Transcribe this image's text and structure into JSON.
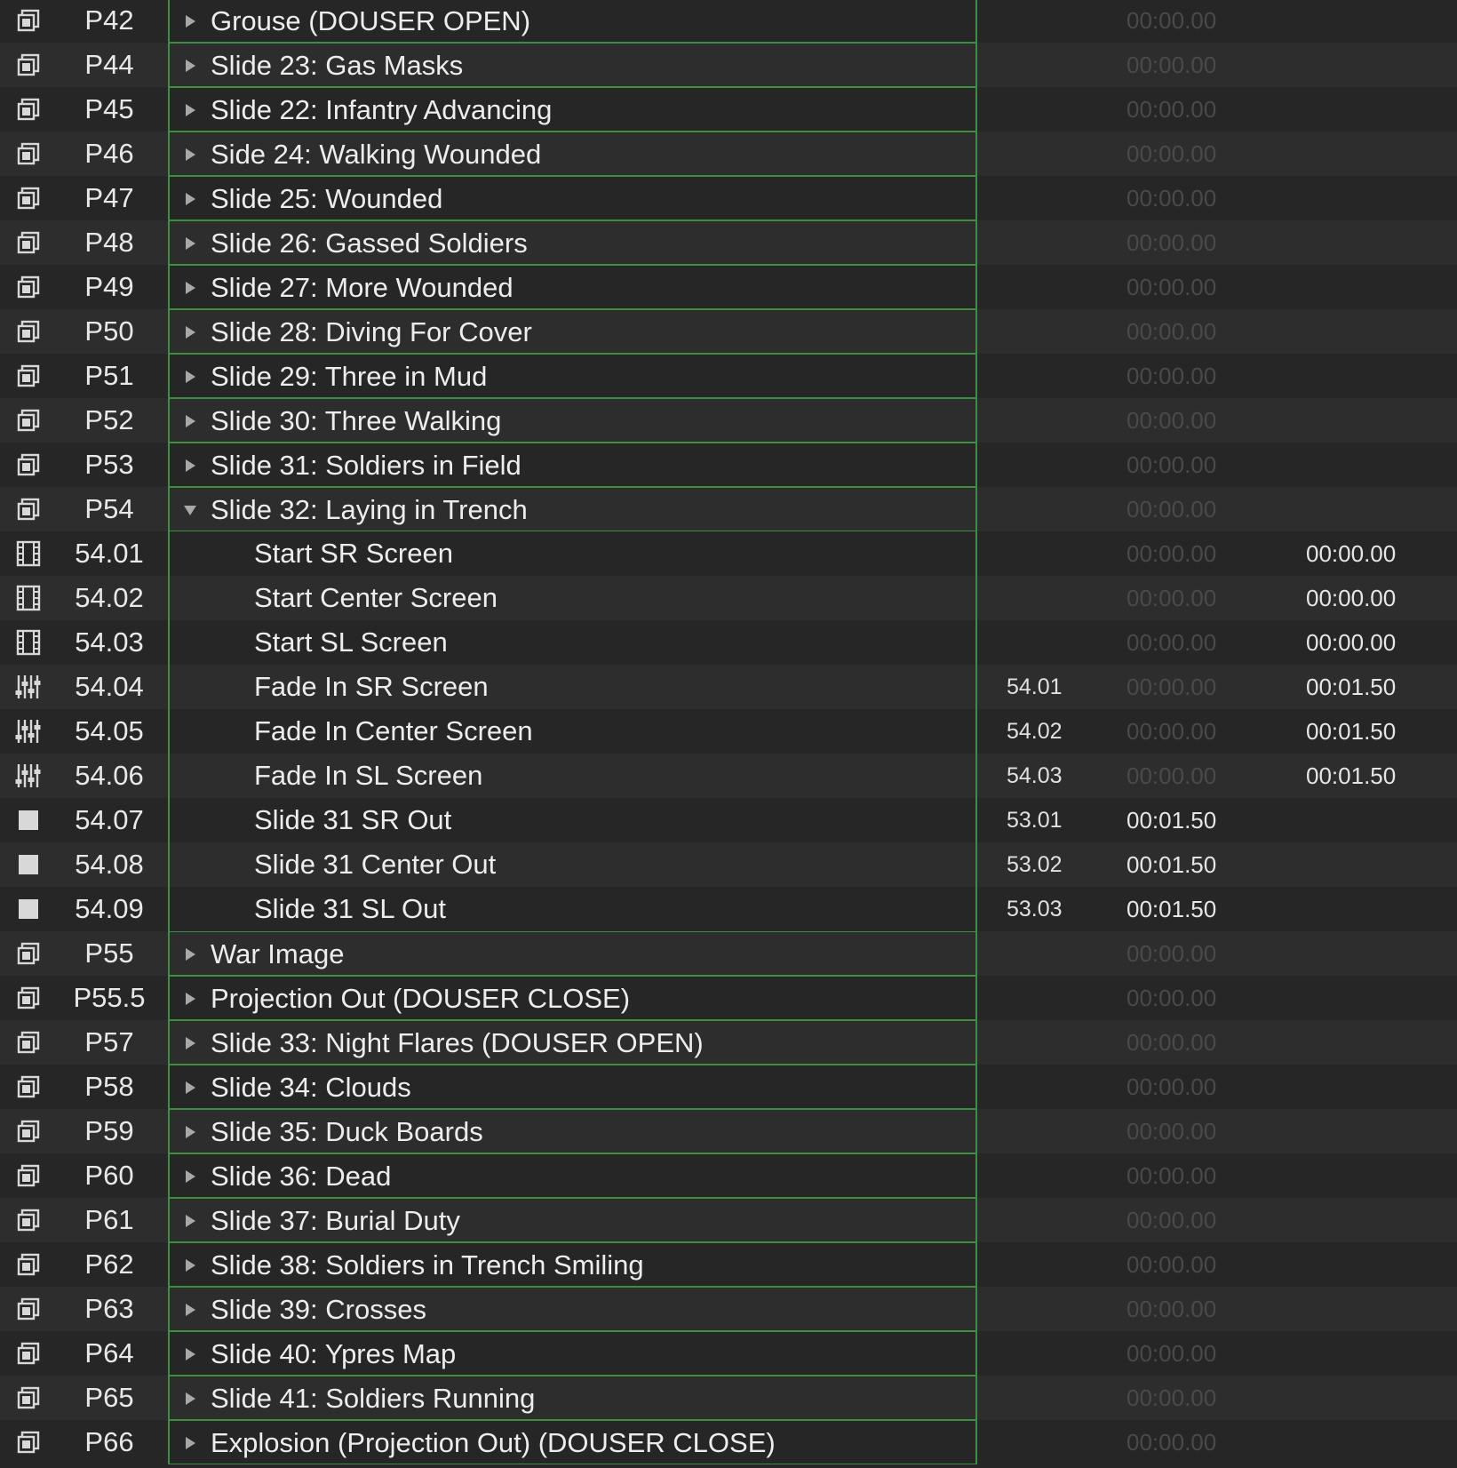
{
  "cues": [
    {
      "number": "P42",
      "name": "Grouse (DOUSER OPEN)",
      "kind": "group",
      "icon": "group-icon",
      "expanded": false,
      "target": "",
      "prewait": "00:00.00",
      "duration": ""
    },
    {
      "number": "P44",
      "name": "Slide 23: Gas Masks",
      "kind": "group",
      "icon": "group-icon",
      "expanded": false,
      "target": "",
      "prewait": "00:00.00",
      "duration": ""
    },
    {
      "number": "P45",
      "name": "Slide 22: Infantry Advancing",
      "kind": "group",
      "icon": "group-icon",
      "expanded": false,
      "target": "",
      "prewait": "00:00.00",
      "duration": ""
    },
    {
      "number": "P46",
      "name": "Side 24: Walking Wounded",
      "kind": "group",
      "icon": "group-icon",
      "expanded": false,
      "target": "",
      "prewait": "00:00.00",
      "duration": ""
    },
    {
      "number": "P47",
      "name": "Slide 25: Wounded",
      "kind": "group",
      "icon": "group-icon",
      "expanded": false,
      "target": "",
      "prewait": "00:00.00",
      "duration": ""
    },
    {
      "number": "P48",
      "name": "Slide 26: Gassed Soldiers",
      "kind": "group",
      "icon": "group-icon",
      "expanded": false,
      "target": "",
      "prewait": "00:00.00",
      "duration": ""
    },
    {
      "number": "P49",
      "name": "Slide 27: More Wounded",
      "kind": "group",
      "icon": "group-icon",
      "expanded": false,
      "target": "",
      "prewait": "00:00.00",
      "duration": ""
    },
    {
      "number": "P50",
      "name": "Slide 28: Diving For Cover",
      "kind": "group",
      "icon": "group-icon",
      "expanded": false,
      "target": "",
      "prewait": "00:00.00",
      "duration": ""
    },
    {
      "number": "P51",
      "name": "Slide 29: Three in Mud",
      "kind": "group",
      "icon": "group-icon",
      "expanded": false,
      "target": "",
      "prewait": "00:00.00",
      "duration": ""
    },
    {
      "number": "P52",
      "name": "Slide 30: Three Walking",
      "kind": "group",
      "icon": "group-icon",
      "expanded": false,
      "target": "",
      "prewait": "00:00.00",
      "duration": ""
    },
    {
      "number": "P53",
      "name": "Slide 31: Soldiers in Field",
      "kind": "group",
      "icon": "group-icon",
      "expanded": false,
      "target": "",
      "prewait": "00:00.00",
      "duration": ""
    },
    {
      "number": "P54",
      "name": "Slide 32: Laying in Trench",
      "kind": "group",
      "icon": "group-icon",
      "expanded": true,
      "target": "",
      "prewait": "00:00.00",
      "duration": ""
    },
    {
      "number": "54.01",
      "name": "Start SR Screen",
      "kind": "child",
      "icon": "video-cue-icon",
      "target": "",
      "prewait": "00:00.00",
      "duration": "00:00.00"
    },
    {
      "number": "54.02",
      "name": "Start Center Screen",
      "kind": "child",
      "icon": "video-cue-icon",
      "target": "",
      "prewait": "00:00.00",
      "duration": "00:00.00"
    },
    {
      "number": "54.03",
      "name": "Start SL Screen",
      "kind": "child",
      "icon": "video-cue-icon",
      "target": "",
      "prewait": "00:00.00",
      "duration": "00:00.00"
    },
    {
      "number": "54.04",
      "name": "Fade In SR Screen",
      "kind": "child",
      "icon": "fade-cue-icon",
      "target": "54.01",
      "prewait": "00:00.00",
      "duration": "00:01.50"
    },
    {
      "number": "54.05",
      "name": "Fade In Center Screen",
      "kind": "child",
      "icon": "fade-cue-icon",
      "target": "54.02",
      "prewait": "00:00.00",
      "duration": "00:01.50"
    },
    {
      "number": "54.06",
      "name": "Fade In SL Screen",
      "kind": "child",
      "icon": "fade-cue-icon",
      "target": "54.03",
      "prewait": "00:00.00",
      "duration": "00:01.50"
    },
    {
      "number": "54.07",
      "name": "Slide 31 SR Out",
      "kind": "child",
      "icon": "stop-cue-icon",
      "target": "53.01",
      "prewait": "00:01.50",
      "prewait_active": true,
      "duration": ""
    },
    {
      "number": "54.08",
      "name": "Slide 31 Center Out",
      "kind": "child",
      "icon": "stop-cue-icon",
      "target": "53.02",
      "prewait": "00:01.50",
      "prewait_active": true,
      "duration": ""
    },
    {
      "number": "54.09",
      "name": "Slide 31 SL Out",
      "kind": "child",
      "icon": "stop-cue-icon",
      "target": "53.03",
      "prewait": "00:01.50",
      "prewait_active": true,
      "duration": ""
    },
    {
      "number": "P55",
      "name": "War Image",
      "kind": "group",
      "icon": "group-icon",
      "expanded": false,
      "target": "",
      "prewait": "00:00.00",
      "duration": ""
    },
    {
      "number": "P55.5",
      "name": "Projection Out (DOUSER CLOSE)",
      "kind": "group",
      "icon": "group-icon",
      "expanded": false,
      "target": "",
      "prewait": "00:00.00",
      "duration": ""
    },
    {
      "number": "P57",
      "name": "Slide 33: Night Flares (DOUSER OPEN)",
      "kind": "group",
      "icon": "group-icon",
      "expanded": false,
      "target": "",
      "prewait": "00:00.00",
      "duration": ""
    },
    {
      "number": "P58",
      "name": "Slide 34: Clouds",
      "kind": "group",
      "icon": "group-icon",
      "expanded": false,
      "target": "",
      "prewait": "00:00.00",
      "duration": ""
    },
    {
      "number": "P59",
      "name": "Slide 35: Duck Boards",
      "kind": "group",
      "icon": "group-icon",
      "expanded": false,
      "target": "",
      "prewait": "00:00.00",
      "duration": ""
    },
    {
      "number": "P60",
      "name": "Slide 36: Dead",
      "kind": "group",
      "icon": "group-icon",
      "expanded": false,
      "target": "",
      "prewait": "00:00.00",
      "duration": ""
    },
    {
      "number": "P61",
      "name": "Slide 37: Burial Duty",
      "kind": "group",
      "icon": "group-icon",
      "expanded": false,
      "target": "",
      "prewait": "00:00.00",
      "duration": ""
    },
    {
      "number": "P62",
      "name": "Slide 38: Soldiers in Trench Smiling",
      "kind": "group",
      "icon": "group-icon",
      "expanded": false,
      "target": "",
      "prewait": "00:00.00",
      "duration": ""
    },
    {
      "number": "P63",
      "name": "Slide 39: Crosses",
      "kind": "group",
      "icon": "group-icon",
      "expanded": false,
      "target": "",
      "prewait": "00:00.00",
      "duration": ""
    },
    {
      "number": "P64",
      "name": "Slide 40: Ypres Map",
      "kind": "group",
      "icon": "group-icon",
      "expanded": false,
      "target": "",
      "prewait": "00:00.00",
      "duration": ""
    },
    {
      "number": "P65",
      "name": "Slide 41: Soldiers Running",
      "kind": "group",
      "icon": "group-icon",
      "expanded": false,
      "target": "",
      "prewait": "00:00.00",
      "duration": ""
    },
    {
      "number": "P66",
      "name": "Explosion (Projection Out) (DOUSER CLOSE)",
      "kind": "group",
      "icon": "group-icon",
      "expanded": false,
      "target": "",
      "prewait": "00:00.00",
      "duration": ""
    }
  ],
  "colors": {
    "background": "#262626",
    "row_alt": "#2d2d2d",
    "group_border": "#3c8f3e",
    "text": "#e6e6e6",
    "dim_time": "#4a4a4a"
  }
}
